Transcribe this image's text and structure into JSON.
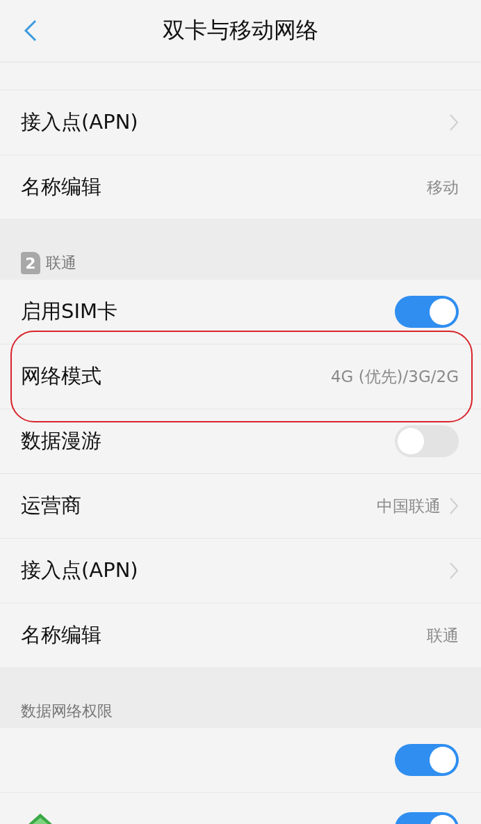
{
  "header": {
    "title": "双卡与移动网络"
  },
  "sections": [
    {
      "rows": [
        {
          "kind": "partial"
        },
        {
          "kind": "link",
          "label": "接入点(APN)"
        },
        {
          "kind": "value",
          "label": "名称编辑",
          "value": "移动"
        }
      ]
    },
    {
      "heading": "联通",
      "sim": "2",
      "rows": [
        {
          "kind": "toggle",
          "label": "启用SIM卡",
          "on": true
        },
        {
          "kind": "value",
          "label": "网络模式",
          "value": "4G (优先)/3G/2G",
          "highlighted": true
        },
        {
          "kind": "toggle",
          "label": "数据漫游",
          "on": false
        },
        {
          "kind": "link",
          "label": "运营商",
          "value": "中国联通"
        },
        {
          "kind": "link",
          "label": "接入点(APN)"
        },
        {
          "kind": "value",
          "label": "名称编辑",
          "value": "联通"
        }
      ]
    },
    {
      "heading": "数据网络权限",
      "rows": [
        {
          "kind": "toggle",
          "on": true
        },
        {
          "kind": "app",
          "on": true
        }
      ]
    }
  ]
}
